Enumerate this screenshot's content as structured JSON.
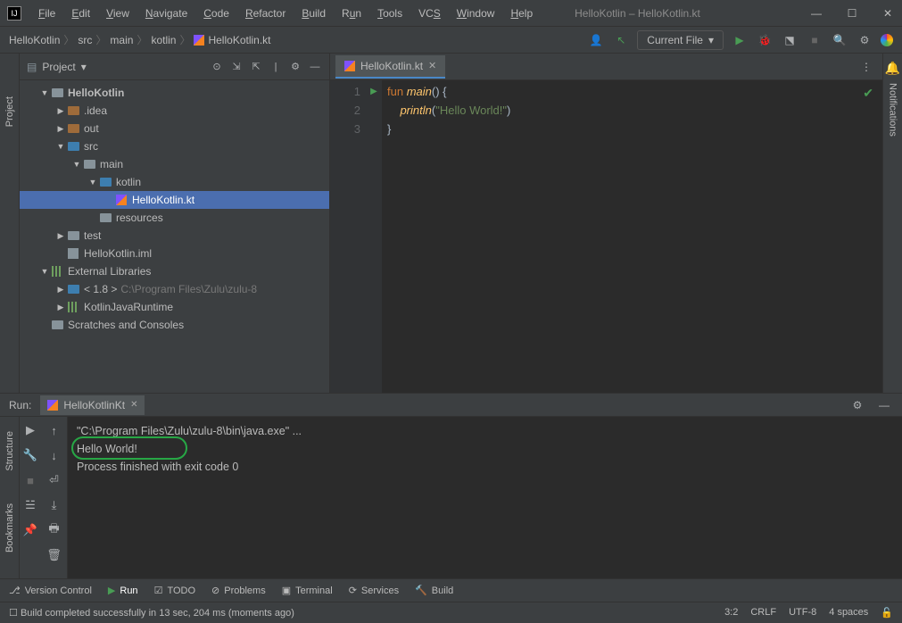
{
  "window": {
    "title": "HelloKotlin – HelloKotlin.kt"
  },
  "menu": [
    "File",
    "Edit",
    "View",
    "Navigate",
    "Code",
    "Refactor",
    "Build",
    "Run",
    "Tools",
    "VCS",
    "Window",
    "Help"
  ],
  "breadcrumb": [
    "HelloKotlin",
    "src",
    "main",
    "kotlin",
    "HelloKotlin.kt"
  ],
  "runConfig": "Current File",
  "projectPanel": {
    "title": "Project"
  },
  "tree": {
    "root": "HelloKotlin",
    "nodes": [
      {
        "label": ".idea",
        "indent": 2,
        "arrow": "▶",
        "icon": "folder-orange"
      },
      {
        "label": "out",
        "indent": 2,
        "arrow": "▶",
        "icon": "folder-orange"
      },
      {
        "label": "src",
        "indent": 2,
        "arrow": "▼",
        "icon": "folder-blue"
      },
      {
        "label": "main",
        "indent": 3,
        "arrow": "▼",
        "icon": "folder"
      },
      {
        "label": "kotlin",
        "indent": 4,
        "arrow": "▼",
        "icon": "folder-blue"
      },
      {
        "label": "HelloKotlin.kt",
        "indent": 5,
        "arrow": "",
        "icon": "kt",
        "selected": true
      },
      {
        "label": "resources",
        "indent": 4,
        "arrow": "",
        "icon": "folder"
      },
      {
        "label": "test",
        "indent": 2,
        "arrow": "▶",
        "icon": "folder"
      },
      {
        "label": "HelloKotlin.iml",
        "indent": 2,
        "arrow": "",
        "icon": "file"
      },
      {
        "label": "External Libraries",
        "indent": 1,
        "arrow": "▼",
        "icon": "lib"
      },
      {
        "label": "< 1.8 >",
        "hint": "C:\\Program Files\\Zulu\\zulu-8",
        "indent": 2,
        "arrow": "▶",
        "icon": "folder-blue"
      },
      {
        "label": "KotlinJavaRuntime",
        "indent": 2,
        "arrow": "▶",
        "icon": "lib"
      },
      {
        "label": "Scratches and Consoles",
        "indent": 1,
        "arrow": "",
        "icon": "folder"
      }
    ]
  },
  "editor": {
    "tabName": "HelloKotlin.kt",
    "lines": [
      "1",
      "2",
      "3"
    ],
    "code": {
      "l1_kw": "fun ",
      "l1_fn": "main",
      "l1_rest": "() ",
      "l1_brace": "{",
      "l2_indent": "    ",
      "l2_fn": "println",
      "l2_paren": "(",
      "l2_str": "\"Hello World!\"",
      "l2_close": ")",
      "l3_brace": "}"
    }
  },
  "runPanel": {
    "label": "Run:",
    "tab": "HelloKotlinKt",
    "output": {
      "line1": "\"C:\\Program Files\\Zulu\\zulu-8\\bin\\java.exe\" ...",
      "line2": "Hello World!",
      "line3": "",
      "line4": "Process finished with exit code 0"
    }
  },
  "bottomBar": [
    "Version Control",
    "Run",
    "TODO",
    "Problems",
    "Terminal",
    "Services",
    "Build"
  ],
  "status": {
    "message": "Build completed successfully in 13 sec, 204 ms (moments ago)",
    "pos": "3:2",
    "eol": "CRLF",
    "enc": "UTF-8",
    "indent": "4 spaces"
  },
  "leftGutter": "Project",
  "leftGutter2": "Structure",
  "leftGutter3": "Bookmarks",
  "rightGutter": "Notifications"
}
